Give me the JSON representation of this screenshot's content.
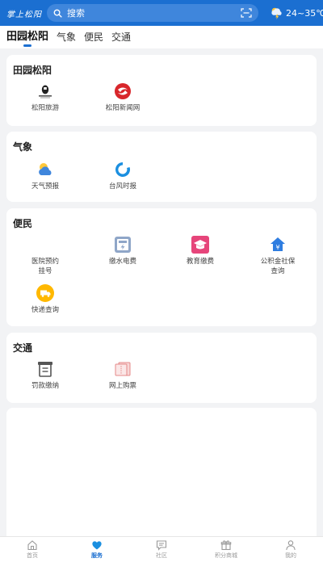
{
  "header": {
    "logo_text": "掌上松阳",
    "search_label": "搜索",
    "weather_temp": "24~35℃"
  },
  "tabs": [
    {
      "label": "田园松阳",
      "active": true
    },
    {
      "label": "气象",
      "active": false
    },
    {
      "label": "便民",
      "active": false
    },
    {
      "label": "交通",
      "active": false
    }
  ],
  "sections": {
    "tianyuan": {
      "title": "田园松阳",
      "items": [
        {
          "label": "松阳旅游",
          "icon": "songyang-tourism-logo-icon"
        },
        {
          "label": "松阳新闻网",
          "icon": "songyang-news-logo-icon"
        }
      ]
    },
    "qixiang": {
      "title": "气象",
      "items": [
        {
          "label": "天气预报",
          "icon": "partly-cloudy-icon"
        },
        {
          "label": "台风时报",
          "icon": "typhoon-icon"
        }
      ]
    },
    "bianmin": {
      "title": "便民",
      "items": [
        {
          "label": "医院预约挂号",
          "icon": "hospital-icon"
        },
        {
          "label": "缴水电费",
          "icon": "utility-bill-icon"
        },
        {
          "label": "教育缴费",
          "icon": "graduation-cap-icon"
        },
        {
          "label": "公积金社保查询",
          "icon": "housing-fund-icon"
        },
        {
          "label": "快递查询",
          "icon": "delivery-truck-icon"
        }
      ]
    },
    "jiaotong": {
      "title": "交通",
      "items": [
        {
          "label": "罚款缴纳",
          "icon": "fine-payment-icon"
        },
        {
          "label": "网上购票",
          "icon": "ticket-icon"
        }
      ]
    }
  },
  "bottom_nav": [
    {
      "label": "首页",
      "icon": "home-icon",
      "active": false
    },
    {
      "label": "服务",
      "icon": "heart-icon",
      "active": true
    },
    {
      "label": "社区",
      "icon": "chat-icon",
      "active": false
    },
    {
      "label": "积分商城",
      "icon": "gift-icon",
      "active": false
    },
    {
      "label": "我的",
      "icon": "user-icon",
      "active": false
    }
  ],
  "colors": {
    "brand_blue": "#1b6fd1",
    "background": "#f2f3f5",
    "card": "#ffffff"
  }
}
